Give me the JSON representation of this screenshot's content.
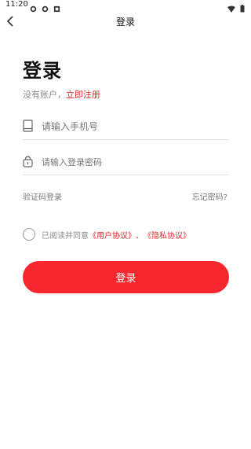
{
  "status_bar": {
    "time": "11:20"
  },
  "nav": {
    "title": "登录"
  },
  "heading": "登录",
  "signup": {
    "prompt": "没有账户，",
    "link": "立即注册"
  },
  "phone": {
    "placeholder": "请输入手机号"
  },
  "password": {
    "placeholder": "请输入登录密码"
  },
  "options": {
    "sms_login": "验证码登录",
    "forgot": "忘记密码?"
  },
  "agreement": {
    "prefix": "已阅读并同意",
    "user_agreement": "《用户协议》",
    "separator": "、",
    "privacy_agreement": "《隐私协议》"
  },
  "login_button": "登录",
  "colors": {
    "accent": "#f7272e"
  }
}
